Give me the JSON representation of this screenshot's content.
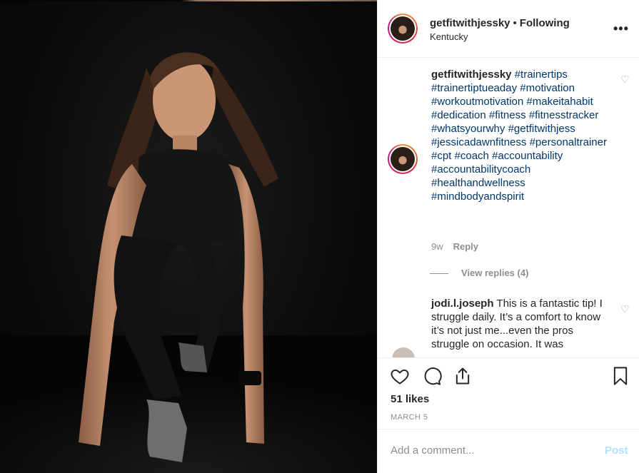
{
  "photo": {
    "alt_icon": "photo-woman-fitness"
  },
  "header": {
    "username": "getfitwithjessky",
    "separator": "•",
    "follow_status": "Following",
    "location": "Kentucky",
    "more_icon": "more-icon"
  },
  "caption": {
    "username": "getfitwithjessky",
    "hashtags": [
      "#trainertips",
      "#trainertiptueaday",
      "#motivation",
      "#workoutmotivation",
      "#makeitahabit",
      "#dedication",
      "#fitness",
      "#fitnesstracker",
      "#whatsyourwhy",
      "#getfitwithjess",
      "#jessicadawnfitness",
      "#personaltrainer",
      "#cpt",
      "#coach",
      "#accountability",
      "#accountabilitycoach",
      "#healthandwellness",
      "#mindbodyandspirit"
    ],
    "time": "9w",
    "reply_label": "Reply",
    "view_replies": "View replies (4)"
  },
  "comment": {
    "username": "jodi.l.joseph",
    "text": "This is a fantastic tip! I struggle daily. It’s a comfort to know it’s not just me...even the pros struggle on occasion. It was"
  },
  "actions": {
    "icons": [
      "heart-icon",
      "comment-icon",
      "share-icon",
      "bookmark-icon"
    ],
    "likes": "51 likes",
    "date": "MARCH 5"
  },
  "add_comment": {
    "placeholder": "Add a comment...",
    "post_label": "Post"
  }
}
